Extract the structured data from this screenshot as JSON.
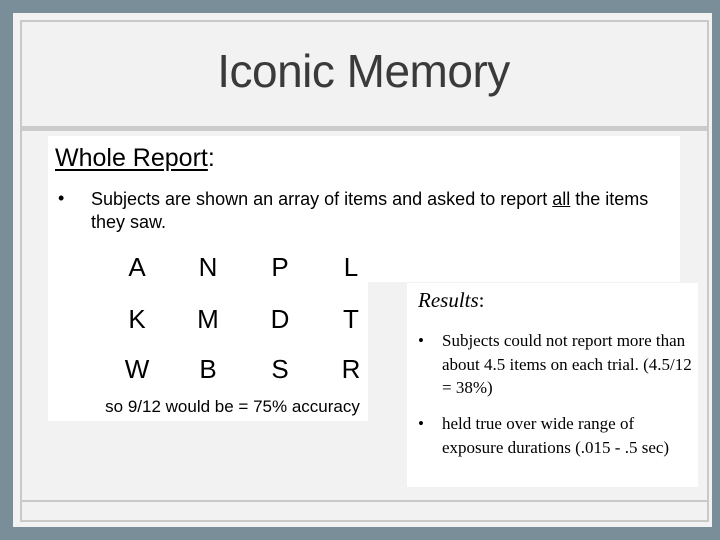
{
  "slide": {
    "title": "Iconic Memory",
    "whole_report": {
      "heading": "Whole Report",
      "heading_suffix": ":",
      "bullet_marker": "•",
      "bullet_text_before": "Subjects are shown an array of items and asked to report ",
      "bullet_text_emphasis": "all",
      "bullet_text_after": " the items they saw."
    },
    "letter_grid": [
      [
        "A",
        "N",
        "P",
        "L"
      ],
      [
        "K",
        "M",
        "D",
        "T"
      ],
      [
        "W",
        "B",
        "S",
        "R"
      ]
    ],
    "accuracy_note": "so 9/12 would be = 75% accuracy",
    "results": {
      "heading": "Results",
      "heading_suffix": ":",
      "bullet_marker": "•",
      "bullets": [
        "Subjects could not report more than about 4.5 items on each trial. (4.5/12 = 38%)",
        "held true over wide range of exposure durations (.015 - .5 sec)"
      ]
    }
  },
  "colors": {
    "background": "#7a8e9a",
    "slide": "#f2f2f2",
    "border": "#c9c9c7",
    "title_text": "#3a3a3a"
  }
}
